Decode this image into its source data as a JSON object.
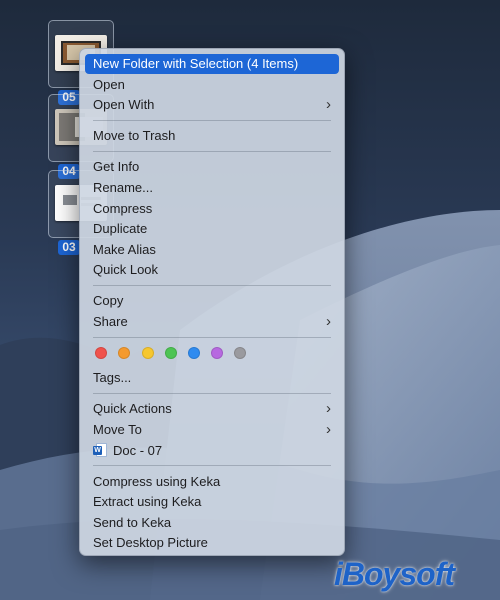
{
  "desktop": {
    "files": [
      {
        "label": "05"
      },
      {
        "label": "04"
      },
      {
        "label": "03"
      }
    ]
  },
  "context_menu": {
    "items": [
      {
        "label": "New Folder with Selection (4 Items)",
        "highlighted": true
      },
      {
        "label": "Open"
      },
      {
        "label": "Open With",
        "submenu": true
      },
      {
        "label": "Move to Trash"
      },
      {
        "label": "Get Info"
      },
      {
        "label": "Rename..."
      },
      {
        "label": "Compress"
      },
      {
        "label": "Duplicate"
      },
      {
        "label": "Make Alias"
      },
      {
        "label": "Quick Look"
      },
      {
        "label": "Copy"
      },
      {
        "label": "Share",
        "submenu": true
      },
      {
        "label": "Tags..."
      },
      {
        "label": "Quick Actions",
        "submenu": true
      },
      {
        "label": "Move To",
        "submenu": true
      },
      {
        "label": "Doc - 07",
        "icon": "word-document-icon"
      },
      {
        "label": "Compress using Keka"
      },
      {
        "label": "Extract using Keka"
      },
      {
        "label": "Send to Keka"
      },
      {
        "label": "Set Desktop Picture"
      }
    ],
    "tag_colors": [
      {
        "name": "red",
        "color": "#f0524c"
      },
      {
        "name": "orange",
        "color": "#f49a2e"
      },
      {
        "name": "yellow",
        "color": "#f6c72f"
      },
      {
        "name": "green",
        "color": "#4dc454"
      },
      {
        "name": "blue",
        "color": "#2f8bf0"
      },
      {
        "name": "purple",
        "color": "#b769e0"
      },
      {
        "name": "gray",
        "color": "#9a9a9f"
      }
    ],
    "highlight_color": "#1d66d6"
  },
  "watermark": {
    "text": "iBoysoft"
  }
}
